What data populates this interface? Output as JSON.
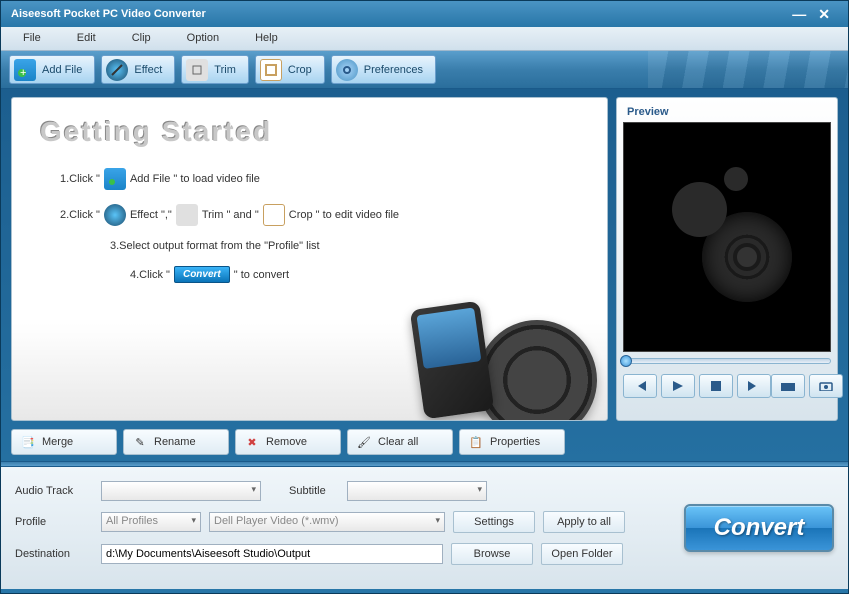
{
  "window": {
    "title": "Aiseesoft Pocket PC Video Converter"
  },
  "menu": {
    "file": "File",
    "edit": "Edit",
    "clip": "Clip",
    "option": "Option",
    "help": "Help"
  },
  "toolbar": {
    "add_file": "Add File",
    "effect": "Effect",
    "trim": "Trim",
    "crop": "Crop",
    "preferences": "Preferences"
  },
  "getting_started": {
    "heading": "Getting    Started",
    "step1_prefix": "1.Click \"",
    "step1_suffix": "Add File \" to load video file",
    "step2_prefix": "2.Click \"",
    "step2_mid1": "Effect \",\"",
    "step2_mid2": "Trim \" and \"",
    "step2_suffix": "Crop \" to edit video file",
    "step3": "3.Select output format from the \"Profile\" list",
    "step4_prefix": "4.Click \"",
    "step4_chip": "Convert",
    "step4_suffix": "\" to convert"
  },
  "preview": {
    "label": "Preview"
  },
  "actions": {
    "merge": "Merge",
    "rename": "Rename",
    "remove": "Remove",
    "clear_all": "Clear all",
    "properties": "Properties"
  },
  "settings": {
    "audio_track_label": "Audio Track",
    "audio_track_value": "",
    "subtitle_label": "Subtitle",
    "subtitle_value": "",
    "profile_label": "Profile",
    "profile_category": "All Profiles",
    "profile_value": "Dell Player Video (*.wmv)",
    "destination_label": "Destination",
    "destination_value": "d:\\My Documents\\Aiseesoft Studio\\Output",
    "settings_btn": "Settings",
    "apply_all_btn": "Apply to all",
    "browse_btn": "Browse",
    "open_folder_btn": "Open Folder"
  },
  "convert": {
    "label": "Convert"
  }
}
